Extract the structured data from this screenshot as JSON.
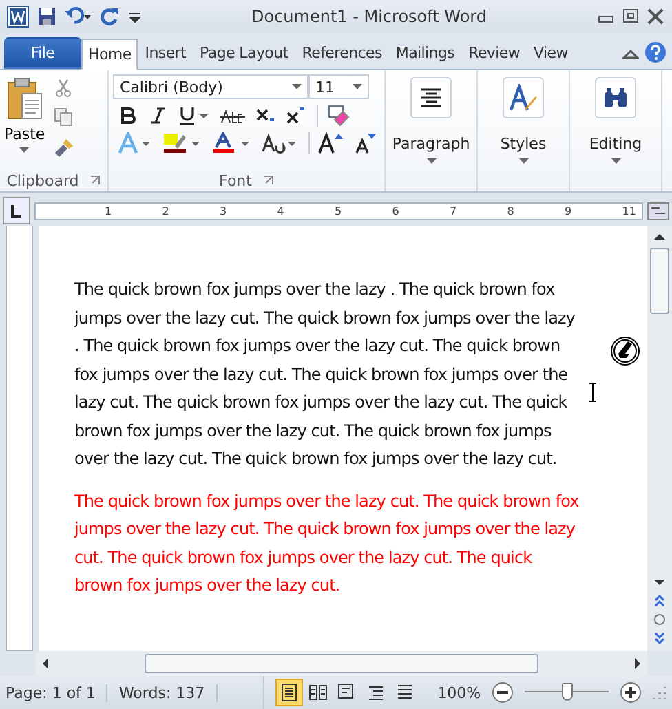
{
  "window": {
    "title": "Document1  -  Microsoft Word"
  },
  "tabs": [
    {
      "label": "File",
      "kind": "file",
      "selected": false
    },
    {
      "label": "Home",
      "kind": "tab",
      "selected": true
    },
    {
      "label": "Insert",
      "kind": "tab",
      "selected": false
    },
    {
      "label": "Page Layout",
      "kind": "tab",
      "selected": false
    },
    {
      "label": "References",
      "kind": "tab",
      "selected": false
    },
    {
      "label": "Mailings",
      "kind": "tab",
      "selected": false
    },
    {
      "label": "Review",
      "kind": "tab",
      "selected": false
    },
    {
      "label": "View",
      "kind": "tab",
      "selected": false
    }
  ],
  "ribbon": {
    "clipboard": {
      "label": "Clipboard",
      "paste": "Paste"
    },
    "font": {
      "label": "Font",
      "family": "Calibri (Body)",
      "size": "11"
    },
    "groups": [
      {
        "label": "Paragraph",
        "kind": "paragraph"
      },
      {
        "label": "Styles",
        "kind": "styles"
      },
      {
        "label": "Editing",
        "kind": "editing"
      }
    ]
  },
  "ruler": {
    "marks": [
      "1",
      "2",
      "3",
      "4",
      "5",
      "6",
      "7",
      "8",
      "9",
      "11"
    ]
  },
  "document": {
    "paragraphs": [
      {
        "kind": "normal",
        "text": "The quick brown fox jumps over the lazy . The quick brown fox jumps over the lazy cut. The quick brown fox jumps over the lazy . The quick brown fox jumps over the lazy cut. The quick brown fox jumps over the lazy cut. The quick brown fox jumps over the lazy cut. The quick brown fox jumps over the lazy cut. The quick brown fox jumps over the lazy cut. The quick brown fox jumps over the lazy cut. The quick brown fox jumps over the lazy cut."
      },
      {
        "kind": "red",
        "text": "The quick brown fox jumps over the lazy cut. The quick brown fox jumps over the lazy cut. The quick brown fox jumps over the lazy cut. The quick brown fox jumps over the lazy cut. The quick brown fox jumps over the lazy cut."
      }
    ]
  },
  "status_bar": {
    "page": "Page: 1 of 1",
    "words": "Words: 137",
    "views": [
      {
        "kind": "print",
        "selected": true
      },
      {
        "kind": "reading",
        "selected": false
      },
      {
        "kind": "web",
        "selected": false
      },
      {
        "kind": "outline",
        "selected": false
      },
      {
        "kind": "draft",
        "selected": false
      }
    ],
    "zoom": "100%",
    "zoom_slider": {
      "level": 0.5
    }
  }
}
